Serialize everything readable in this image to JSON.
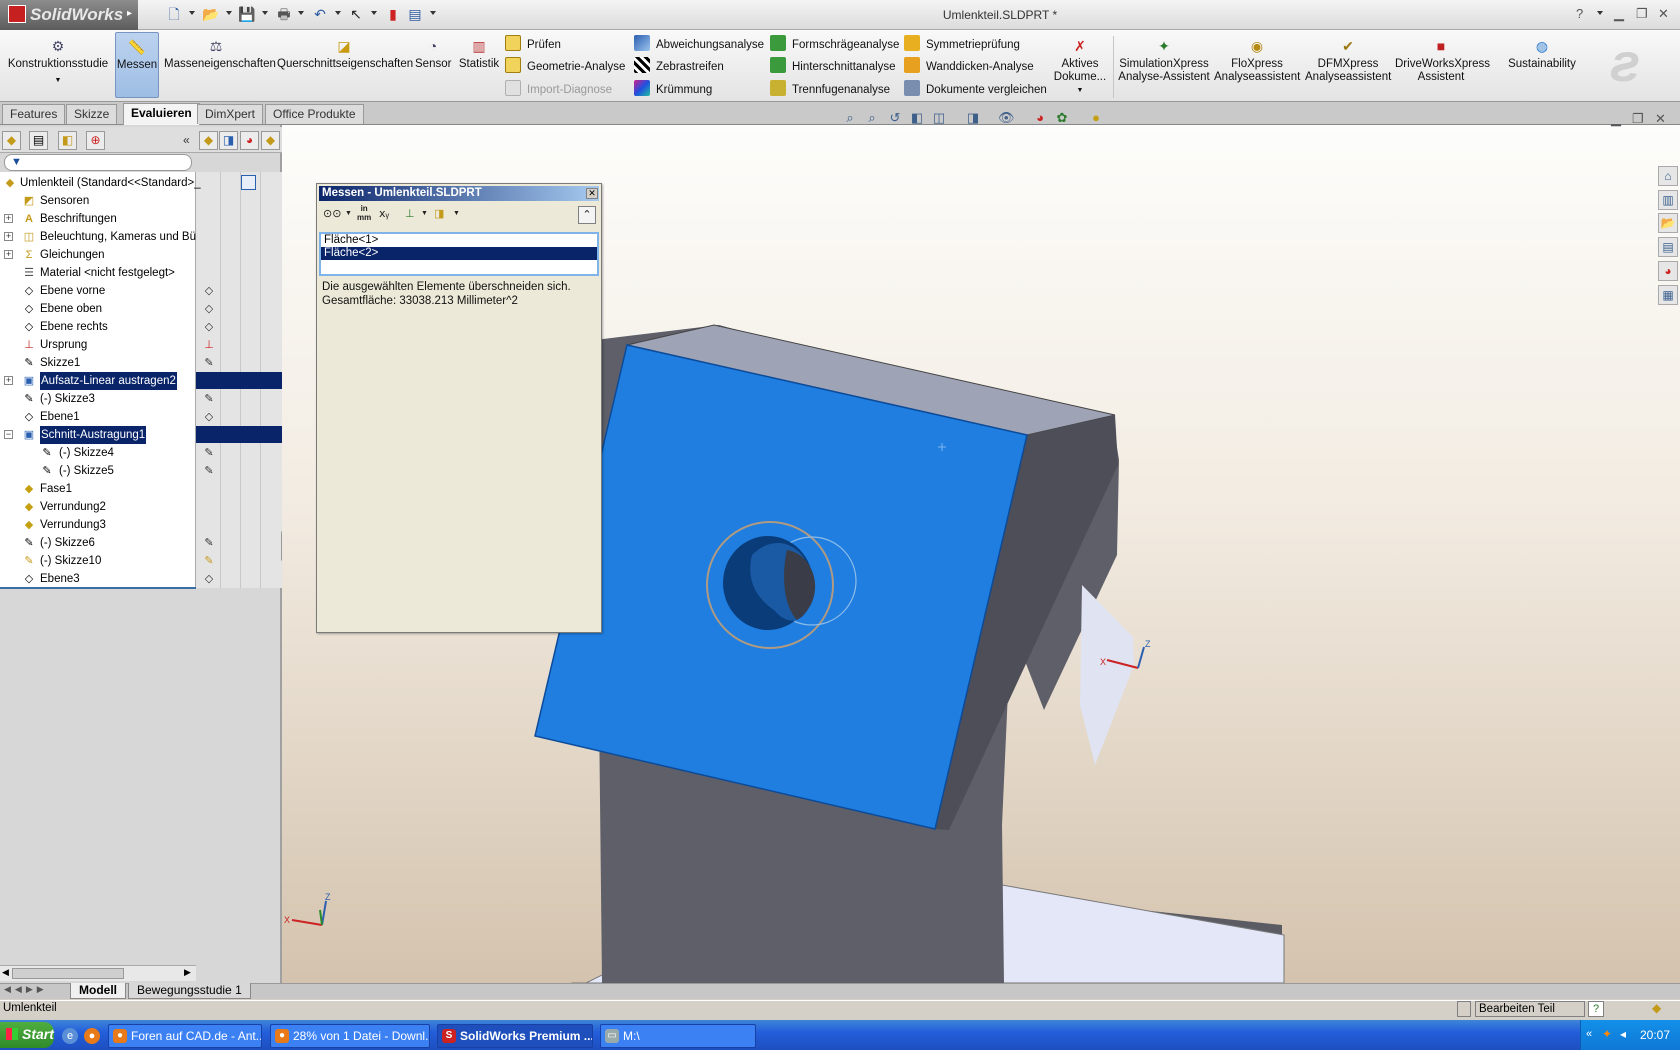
{
  "app": {
    "logo": "SolidWorks",
    "document_title": "Umlenkteil.SLDPRT *",
    "help_icon": "?"
  },
  "ribbon": {
    "konstruktionsstudie": "Konstruktionsstudie",
    "messen": "Messen",
    "masseneigenschaften": "Masseneigenschaften",
    "querschnitt": "Querschnittseigenschaften",
    "sensor": "Sensor",
    "statistik": "Statistik",
    "pruefen": "Prüfen",
    "geometrie_analyse": "Geometrie-Analyse",
    "import_diagnose": "Import-Diagnose",
    "abweichungsanalyse": "Abweichungsanalyse",
    "zebrastreifen": "Zebrastreifen",
    "kruemmung": "Krümmung",
    "formschraege": "Formschrägeanalyse",
    "hinterschnitt": "Hinterschnittanalyse",
    "trennfugen": "Trennfugenanalyse",
    "symmetrie": "Symmetrieprüfung",
    "wanddicken": "Wanddicken-Analyse",
    "dokumente_vergleichen": "Dokumente vergleichen",
    "aktives_dok_1": "Aktives",
    "aktives_dok_2": "Dokume...",
    "simxpress_1": "SimulationXpress",
    "simxpress_2": "Analyse-Assistent",
    "floxpress_1": "FloXpress",
    "floxpress_2": "Analyseassistent",
    "dfmxpress_1": "DFMXpress",
    "dfmxpress_2": "Analyseassistent",
    "driveworks_1": "DriveWorksXpress",
    "driveworks_2": "Assistent",
    "sustainability": "Sustainability"
  },
  "tabs": [
    "Features",
    "Skizze",
    "Evaluieren",
    "DimXpert",
    "Office Produkte"
  ],
  "tree": {
    "root": "Umlenkteil  (Standard<<Standard>_",
    "items": [
      "Sensoren",
      "Beschriftungen",
      "Beleuchtung, Kameras und Bühn",
      "Gleichungen",
      "Material <nicht festgelegt>",
      "Ebene vorne",
      "Ebene oben",
      "Ebene rechts",
      "Ursprung",
      "Skizze1",
      "Aufsatz-Linear austragen2",
      "(-) Skizze3",
      "Ebene1",
      "Schnitt-Austragung1",
      "(-) Skizze4",
      "(-) Skizze5",
      "Fase1",
      "Verrundung2",
      "Verrundung3",
      "(-) Skizze6",
      "(-) Skizze10",
      "Ebene3"
    ]
  },
  "measure": {
    "title": "Messen - Umlenkteil.SLDPRT",
    "units_top": "in",
    "units_bottom": "mm",
    "selections": [
      "Fläche<1>",
      "Fläche<2>"
    ],
    "result_line1": "Die ausgewählten Elemente überschneiden sich.",
    "result_line2": "Gesamtfläche: 33038.213 Millimeter^2"
  },
  "bottom_tabs": [
    "Modell",
    "Bewegungsstudie 1"
  ],
  "status": {
    "left": "Umlenkteil",
    "right": "Bearbeiten Teil"
  },
  "taskbar": {
    "start": "Start",
    "tasks": [
      "Foren auf CAD.de - Ant...",
      "28% von 1 Datei - Downl...",
      "SolidWorks Premium ...",
      "M:\\"
    ],
    "clock": "20:07"
  },
  "colors": {
    "face_blue": "#1f7ee0",
    "body_gray": "#55565f",
    "selection": "#0a246a"
  }
}
